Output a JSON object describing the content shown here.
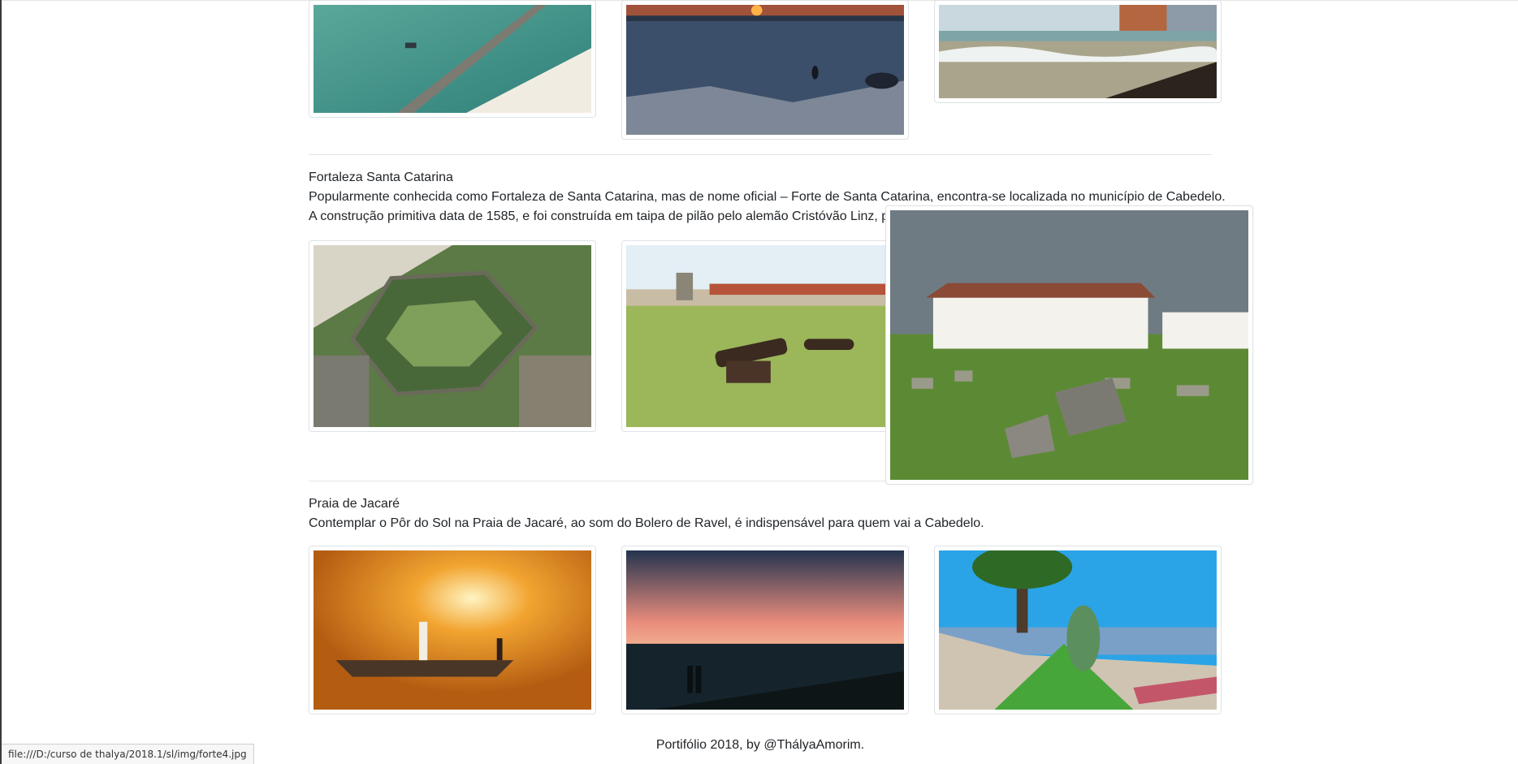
{
  "sections": [
    {
      "images": [
        {
          "alt": "Vista aérea do quebra-mar com rebocador"
        },
        {
          "alt": "Pôr do sol no mar com pessoa na água"
        },
        {
          "alt": "Praia com ondas e prédios ao fundo"
        }
      ]
    },
    {
      "title": "Fortaleza Santa Catarina",
      "text_line1": "Popularmente conhecida como Fortaleza de Santa Catarina, mas de nome oficial – Forte de Santa Catarina, encontra-se localizada no município de Cabedelo.",
      "text_line2": "A construção primitiva data de 1585, e foi construída em taipa de pilão pelo alemão Cristóvão Linz, p",
      "images": [
        {
          "alt": "Vista aérea da fortaleza em forma de estrela"
        },
        {
          "alt": "Canhões antigos no gramado da fortaleza"
        },
        {
          "alt": "Casarão branco com arcos e pedras no gramado"
        }
      ]
    },
    {
      "title": "Praia de Jacaré",
      "text_line1": "Contemplar o Pôr do Sol na Praia de Jacaré, ao som do Bolero de Ravel, é indispensável para quem vai a Cabedelo.",
      "images": [
        {
          "alt": "Barco com saxofonista ao pôr do sol"
        },
        {
          "alt": "Casal no píer ao entardecer"
        },
        {
          "alt": "Estátua de jacaré no calçadão da praia"
        }
      ]
    }
  ],
  "footer": "Portifólio 2018, by @ThályaAmorim.",
  "status_url": "file:///D:/curso de thalya/2018.1/sl/img/forte4.jpg",
  "colors": {
    "text": "#212529",
    "border": "#dee2e6",
    "separator": "#e3e3e3"
  }
}
